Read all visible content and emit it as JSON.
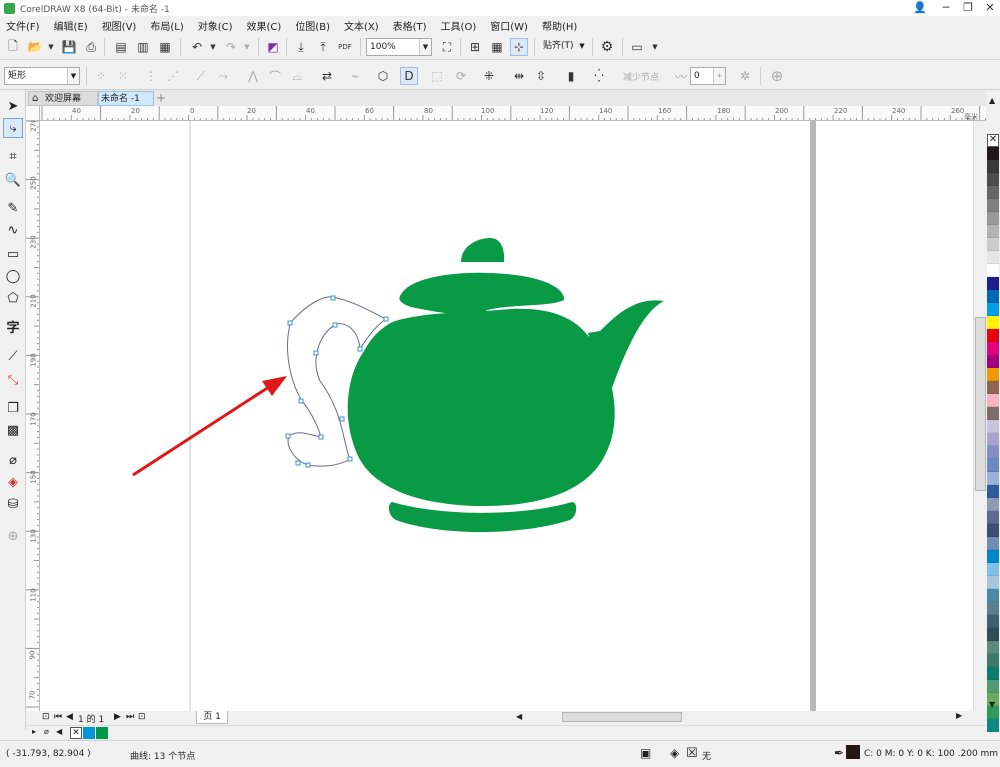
{
  "window": {
    "title": "CorelDRAW X8 (64-Bit) - 未命名 -1",
    "minimize": "─",
    "restore": "❐",
    "close": "✕",
    "profile": "👤"
  },
  "menu": [
    "文件(F)",
    "编辑(E)",
    "视图(V)",
    "布局(L)",
    "对象(C)",
    "效果(C)",
    "位图(B)",
    "文本(X)",
    "表格(T)",
    "工具(O)",
    "窗口(W)",
    "帮助(H)"
  ],
  "standard_toolbar": {
    "zoom_value": "100%",
    "snap_label": "贴齐(T)",
    "pdf_label": "PDF"
  },
  "property_bar": {
    "object_type": "矩形",
    "reduce_nodes_label": "减少节点",
    "smoothing_value": "0"
  },
  "tabs": {
    "welcome": "欢迎屏幕",
    "document": "未命名 -1",
    "add": "+"
  },
  "rulers": {
    "unit": "毫米",
    "h_labels": [
      "40",
      "20",
      "0",
      "20",
      "40",
      "60",
      "80",
      "100",
      "120",
      "140",
      "160",
      "180",
      "200",
      "220",
      "240",
      "260"
    ],
    "v_labels": [
      "270",
      "250",
      "230",
      "210",
      "190",
      "170",
      "150",
      "130",
      "110",
      "90",
      "70"
    ]
  },
  "page_nav": {
    "count_text": "1 的 1",
    "page_tab": "页 1"
  },
  "colors": {
    "teapot_green": "#089a44",
    "arrow_red": "#e01717",
    "selection_blue": "#3c8fd6"
  },
  "palette": [
    "#ffffff",
    "#231815",
    "#3a3a3a",
    "#4d4d4d",
    "#666666",
    "#808080",
    "#999999",
    "#b3b3b3",
    "#cccccc",
    "#e6e6e6",
    "#ffffff",
    "#1d2088",
    "#0068b7",
    "#00a0e9",
    "#fff100",
    "#e60012",
    "#e4007f",
    "#a40081",
    "#f39800",
    "#8f6552",
    "#f4b4c1",
    "#7d6e6e",
    "#c9c3e0",
    "#aaa2cf",
    "#7f8ec5",
    "#6b88c4",
    "#9bb3d8",
    "#2e5b9c",
    "#8d9bb2",
    "#5a6b8f",
    "#3c4e75",
    "#6d8db5",
    "#0086cc",
    "#7fc1e6",
    "#a7c6d9",
    "#4b8aa6",
    "#5a7f8f",
    "#3b6270",
    "#2c4f58",
    "#5b8a7d",
    "#3d7a6b",
    "#0a7d6e",
    "#4f9c74",
    "#6bab5e",
    "#2e9a5b",
    "#0e8a84"
  ],
  "document_palette": [
    "none",
    "#0095d9",
    "#009944"
  ],
  "status": {
    "coords": "( -31.793, 82.904 )",
    "object_info": "曲线: 13 个节点",
    "fill_none": "无",
    "outline_info": "C: 0 M: 0 Y: 0 K: 100  .200 mm"
  }
}
